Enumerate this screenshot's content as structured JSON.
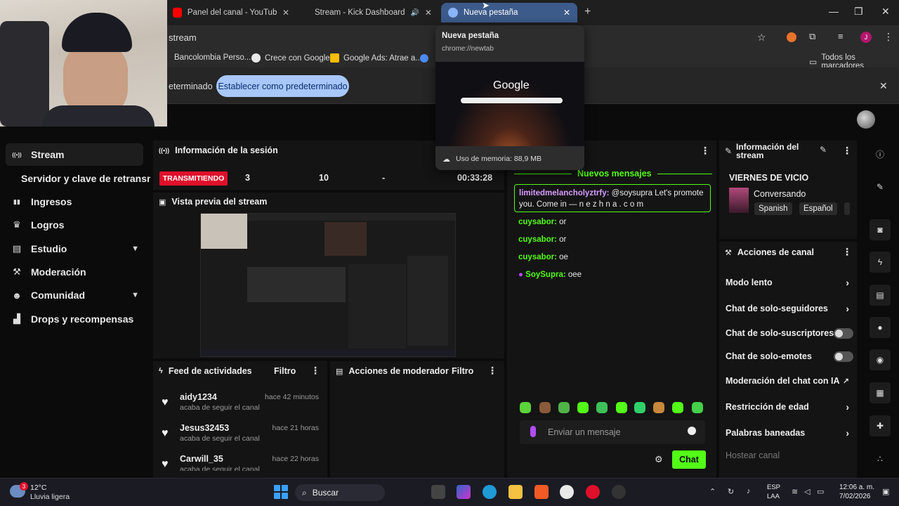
{
  "browser": {
    "tabs": [
      {
        "title": "Panel del canal - YouTube Studi",
        "close": "✕"
      },
      {
        "title": "Stream - Kick Dashboard",
        "close": "✕",
        "audio": "🔊"
      },
      {
        "title": "Nueva pestaña",
        "close": "✕"
      }
    ],
    "new_tab": "+",
    "window_controls": {
      "minimize": "—",
      "maximize": "❐",
      "close": "✕"
    },
    "url": "stream",
    "bookmarks": [
      "Bancolombia Perso...",
      "Crece con Google",
      "Google Ads: Atrae a..."
    ],
    "all_bookmarks": "Todos los marcadores",
    "infobar": {
      "text": "eterminado",
      "button": "Establecer como predeterminado",
      "close": "✕"
    },
    "hover_card": {
      "title": "Nueva pestaña",
      "url": "chrome://newtab",
      "thumb_logo": "Google",
      "memory": "Uso de memoria: 88,9 MB"
    },
    "profile_initial": "J"
  },
  "sidebar": {
    "items": [
      {
        "label": "Stream",
        "icon": "live-icon",
        "glyph": "((•))"
      },
      {
        "label": "Servidor y clave de retransm",
        "icon": "",
        "glyph": ""
      },
      {
        "label": "Ingresos",
        "icon": "chart-icon",
        "glyph": "▮▮"
      },
      {
        "label": "Logros",
        "icon": "trophy-icon",
        "glyph": "♛"
      },
      {
        "label": "Estudio",
        "icon": "layout-icon",
        "glyph": "▤",
        "chevron": "⌄"
      },
      {
        "label": "Moderación",
        "icon": "hammer-icon",
        "glyph": "⚒"
      },
      {
        "label": "Comunidad",
        "icon": "users-icon",
        "glyph": "👥",
        "chevron": "⌄"
      },
      {
        "label": "Drops y recompensas",
        "icon": "gift-icon",
        "glyph": "▟"
      }
    ]
  },
  "session": {
    "title": "Información de la sesión",
    "status": "TRANSMITIENDO",
    "viewers": "3",
    "followers": "10",
    "subs": "-",
    "duration": "00:33:28"
  },
  "preview": {
    "title": "Vista previa del stream"
  },
  "feed": {
    "title": "Feed de actividades",
    "filter": "Filtro",
    "items": [
      {
        "user": "aidy1234",
        "time": "hace 42 minutos",
        "action": "acaba de seguir el canal"
      },
      {
        "user": "Jesus32453",
        "time": "hace 21 horas",
        "action": "acaba de seguir el canal"
      },
      {
        "user": "Carwill_35",
        "time": "hace 22 horas",
        "action": "acaba de seguir el canal"
      }
    ]
  },
  "moderator": {
    "title": "Acciones de moderador",
    "filter": "Filtro"
  },
  "chat": {
    "new_messages": "Nuevos mensajes",
    "pinned": {
      "user": "limitedmelancholyztrfy:",
      "text": " @soysupra Let's promote you. Come in — n e z h n a . c o m"
    },
    "messages": [
      {
        "user": "cuysabor:",
        "text": " or"
      },
      {
        "user": "cuysabor:",
        "text": " or"
      },
      {
        "user": "cuysabor:",
        "text": " oe"
      },
      {
        "user": "SoySupra:",
        "text": " oee"
      }
    ],
    "placeholder": "Enviar un mensaje",
    "send": "Chat"
  },
  "stream_info": {
    "title_line1": "Información del",
    "title_line2": "stream",
    "stream_title": "VIERNES DE VICIO",
    "category": "Conversando",
    "tags": [
      "Spanish",
      "Español"
    ]
  },
  "channel_actions": {
    "title": "Acciones de canal",
    "items": [
      {
        "label": "Modo lento",
        "control": "chevron"
      },
      {
        "label": "Chat de solo-seguidores",
        "control": "chevron"
      },
      {
        "label": "Chat de solo-suscriptores",
        "control": "toggle",
        "on": false
      },
      {
        "label": "Chat de solo-emotes",
        "control": "toggle",
        "on": false
      },
      {
        "label": "Moderación del chat con IA",
        "control": "external"
      },
      {
        "label": "Restricción de edad",
        "control": "chevron"
      },
      {
        "label": "Palabras baneadas",
        "control": "chevron"
      },
      {
        "label": "Hostear canal",
        "control": "none"
      }
    ]
  },
  "taskbar": {
    "weather_temp": "12°C",
    "weather_desc": "Lluvia ligera",
    "weather_badge": "3",
    "search": "Buscar",
    "lang1": "ESP",
    "lang2": "LAA",
    "time": "12:06 a. m.",
    "date": "7/02/2026"
  },
  "colors": {
    "kick_green": "#53fc18",
    "live_red": "#e0102b",
    "chrome_blue": "#a8c7fa"
  }
}
